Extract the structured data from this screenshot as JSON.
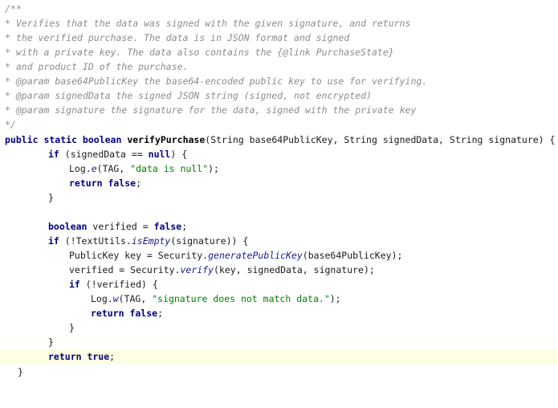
{
  "comment": {
    "l1": "/**",
    "l2": "* Verifies that the data was signed with the given signature, and returns",
    "l3": "* the verified purchase. The data is in JSON format and signed",
    "l4": "* with a private key. The data also contains the {@link PurchaseState}",
    "l5": "* and product ID of the purchase.",
    "l6_star": "* ",
    "l6_tag": "@param",
    "l6_rest": " base64PublicKey the base64-encoded public key to use for verifying.",
    "l7_star": "* ",
    "l7_tag": "@param",
    "l7_rest": " signedData the signed JSON string (signed, not encrypted)",
    "l8_star": "* ",
    "l8_tag": "@param",
    "l8_rest": " signature the signature for the data, signed with the private key",
    "l9": "*/"
  },
  "code": {
    "sig_kw": "public static boolean ",
    "sig_name": "verifyPurchase",
    "sig_rest": "(String base64PublicKey, String signedData, String signature) {",
    "if1_kw": "if",
    "if1_a": " (signedData == ",
    "if1_null": "null",
    "if1_b": ") {",
    "log1_a": "Log.",
    "log1_m": "e",
    "log1_b": "(TAG, ",
    "log1_str": "\"data is null\"",
    "log1_c": ");",
    "ret1_kw": "return false",
    "ret1_end": ";",
    "close1": "}",
    "bool_kw": "boolean",
    "bool_a": " verified = ",
    "bool_false": "false",
    "bool_end": ";",
    "if2_kw": "if",
    "if2_a": " (!TextUtils.",
    "if2_m": "isEmpty",
    "if2_b": "(signature)) {",
    "pk_a": "PublicKey key = Security.",
    "pk_m": "generatePublicKey",
    "pk_b": "(base64PublicKey);",
    "ver_a": "verified = Security.",
    "ver_m": "verify",
    "ver_b": "(key, signedData, signature);",
    "if3_kw": "if",
    "if3_a": " (!verified) {",
    "log2_a": "Log.",
    "log2_m": "w",
    "log2_b": "(TAG, ",
    "log2_str": "\"signature does not match data.\"",
    "log2_c": ");",
    "ret2_kw": "return false",
    "ret2_end": ";",
    "close3": "}",
    "close2": "}",
    "ret3_kw": "return true",
    "ret3_end": ";",
    "close_method": "}"
  }
}
